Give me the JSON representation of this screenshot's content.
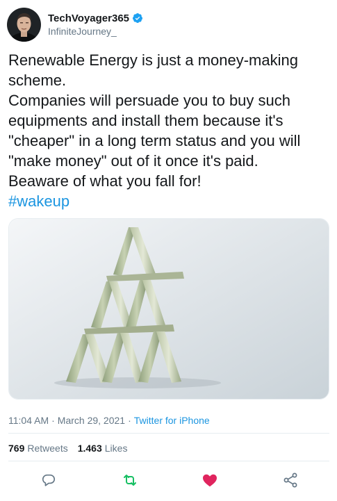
{
  "author": {
    "display_name": "TechVoyager365",
    "handle": "InfiniteJourney_",
    "verified": true
  },
  "tweet": {
    "lines": [
      "Renewable Energy is just a money-making",
      "scheme.",
      "Companies will persuade you to buy such",
      "equipments and install them because it's",
      "\"cheaper\" in a long term status and you will",
      "\"make money\" out of it once it's paid.",
      "Beaware of what you fall for!"
    ],
    "hashtag": "#wakeup"
  },
  "media": {
    "description_icon": "money-card-pyramid-photo"
  },
  "meta": {
    "time": "11:04 AM",
    "date": "March 29, 2021",
    "separator": "·",
    "source": "Twitter for iPhone"
  },
  "stats": {
    "retweets_count": "769",
    "retweets_label": "Retweets",
    "likes_count": "1.463",
    "likes_label": "Likes"
  },
  "actions": {
    "reply_icon": "reply-icon",
    "retweet_icon": "retweet-icon",
    "like_icon": "heart-icon",
    "share_icon": "share-icon"
  },
  "colors": {
    "link": "#1b95e0",
    "secondary_text": "#657786",
    "verified": "#1da1f2",
    "retweet": "#17bf63",
    "like": "#e0245e",
    "divider": "#e6ecf0"
  }
}
